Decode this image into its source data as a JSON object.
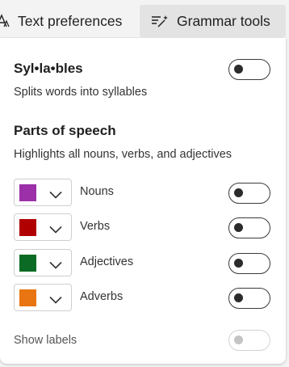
{
  "tabs": [
    {
      "label": "Text preferences",
      "icon": "text-size-icon",
      "selected": false
    },
    {
      "label": "Grammar tools",
      "icon": "grammar-wand-icon",
      "selected": true
    }
  ],
  "syllables": {
    "title": "Syl•la•bles",
    "description": "Splits words into syllables",
    "enabled": false
  },
  "parts_of_speech": {
    "title": "Parts of speech",
    "description": "Highlights all nouns, verbs, and adjectives",
    "items": [
      {
        "label": "Nouns",
        "color": "#9b30a8",
        "enabled": false
      },
      {
        "label": "Verbs",
        "color": "#b00000",
        "enabled": false
      },
      {
        "label": "Adjectives",
        "color": "#0b6b24",
        "enabled": false
      },
      {
        "label": "Adverbs",
        "color": "#e87511",
        "enabled": false
      }
    ]
  },
  "show_labels": {
    "label": "Show labels",
    "enabled": false,
    "disabled": true
  }
}
